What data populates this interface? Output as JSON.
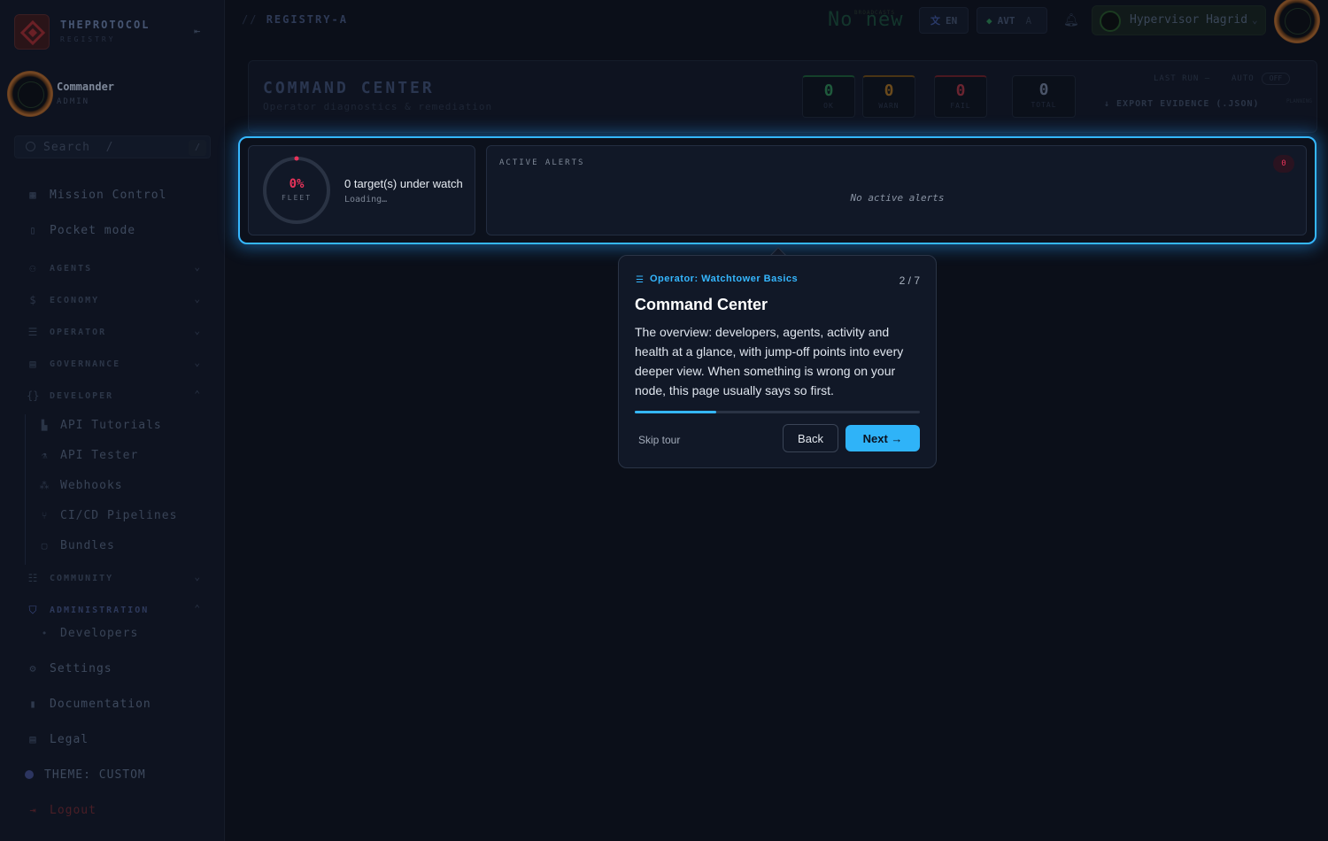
{
  "brand": {
    "name": "THEPROTOCOL",
    "sub": "REGISTRY"
  },
  "user": {
    "name": "Commander",
    "role": "ADMIN"
  },
  "search": {
    "placeholder": "Search  /",
    "kbd": "/"
  },
  "nav": {
    "top": [
      {
        "label": "Mission Control",
        "icon": "grid-icon"
      },
      {
        "label": "Pocket mode",
        "icon": "phone-icon"
      }
    ],
    "sections": [
      {
        "label": "AGENTS",
        "icon": "robot-icon",
        "expanded": false
      },
      {
        "label": "ECONOMY",
        "icon": "dollar-icon",
        "expanded": false
      },
      {
        "label": "OPERATOR",
        "icon": "server-icon",
        "expanded": false
      },
      {
        "label": "GOVERNANCE",
        "icon": "table-icon",
        "expanded": false
      },
      {
        "label": "DEVELOPER",
        "icon": "braces-icon",
        "expanded": true
      },
      {
        "label": "COMMUNITY",
        "icon": "people-icon",
        "expanded": false
      },
      {
        "label": "ADMINISTRATION",
        "icon": "shield-icon",
        "expanded": true
      }
    ],
    "developer_items": [
      {
        "label": "API Tutorials",
        "icon": "file-icon"
      },
      {
        "label": "API Tester",
        "icon": "beaker-icon"
      },
      {
        "label": "Webhooks",
        "icon": "webhook-icon"
      },
      {
        "label": "CI/CD Pipelines",
        "icon": "branch-icon"
      },
      {
        "label": "Bundles",
        "icon": "box-icon"
      }
    ],
    "admin_items": [
      {
        "label": "Developers",
        "icon": "user-icon"
      }
    ],
    "bottom": [
      {
        "label": "Settings",
        "icon": "gear-icon"
      },
      {
        "label": "Documentation",
        "icon": "book-icon"
      },
      {
        "label": "Legal",
        "icon": "legal-icon"
      },
      {
        "label": "THEME: CUSTOM",
        "icon": "theme-dot-icon"
      },
      {
        "label": "Logout",
        "icon": "logout-icon"
      }
    ]
  },
  "topbar": {
    "breadcrumb_prefix": "//",
    "breadcrumb": "REGISTRY-A",
    "ticker_label": "BROADCASTS",
    "ticker": "No new",
    "lang": "EN",
    "token": "AVT",
    "token_sub": "A",
    "account": "Hypervisor Hagrid"
  },
  "panel": {
    "title": "COMMAND CENTER",
    "subtitle": "Operator diagnostics & remediation",
    "stats": [
      {
        "key": "OK",
        "value": "0",
        "color": "#1f5a3c"
      },
      {
        "key": "WARN",
        "value": "0",
        "color": "#6a4a1c"
      },
      {
        "key": "FAIL",
        "value": "0",
        "color": "#6a2430"
      },
      {
        "key": "TOTAL",
        "value": "0",
        "color": "#4a5468"
      }
    ],
    "last_run": "LAST RUN —",
    "auto_label": "AUTO",
    "auto_state": "OFF",
    "export": "↓ EXPORT EVIDENCE (.JSON)",
    "planning": "PLANNING"
  },
  "fleet": {
    "percent_label": "0%",
    "percent": 0,
    "label": "FLEET",
    "count_text": "0 target(s) under watch",
    "loading": "Loading…"
  },
  "alerts": {
    "title": "ACTIVE ALERTS",
    "count": "0",
    "empty": "No active alerts"
  },
  "tour": {
    "tag": "Operator: Watchtower Basics",
    "step": "2 / 7",
    "progress": 0.2857,
    "title": "Command Center",
    "body": "The overview: developers, agents, activity and health at a glance, with jump-off points into every deeper view. When something is wrong on your node, this page usually says so first.",
    "skip": "Skip tour",
    "back": "Back",
    "next": "Next →"
  }
}
